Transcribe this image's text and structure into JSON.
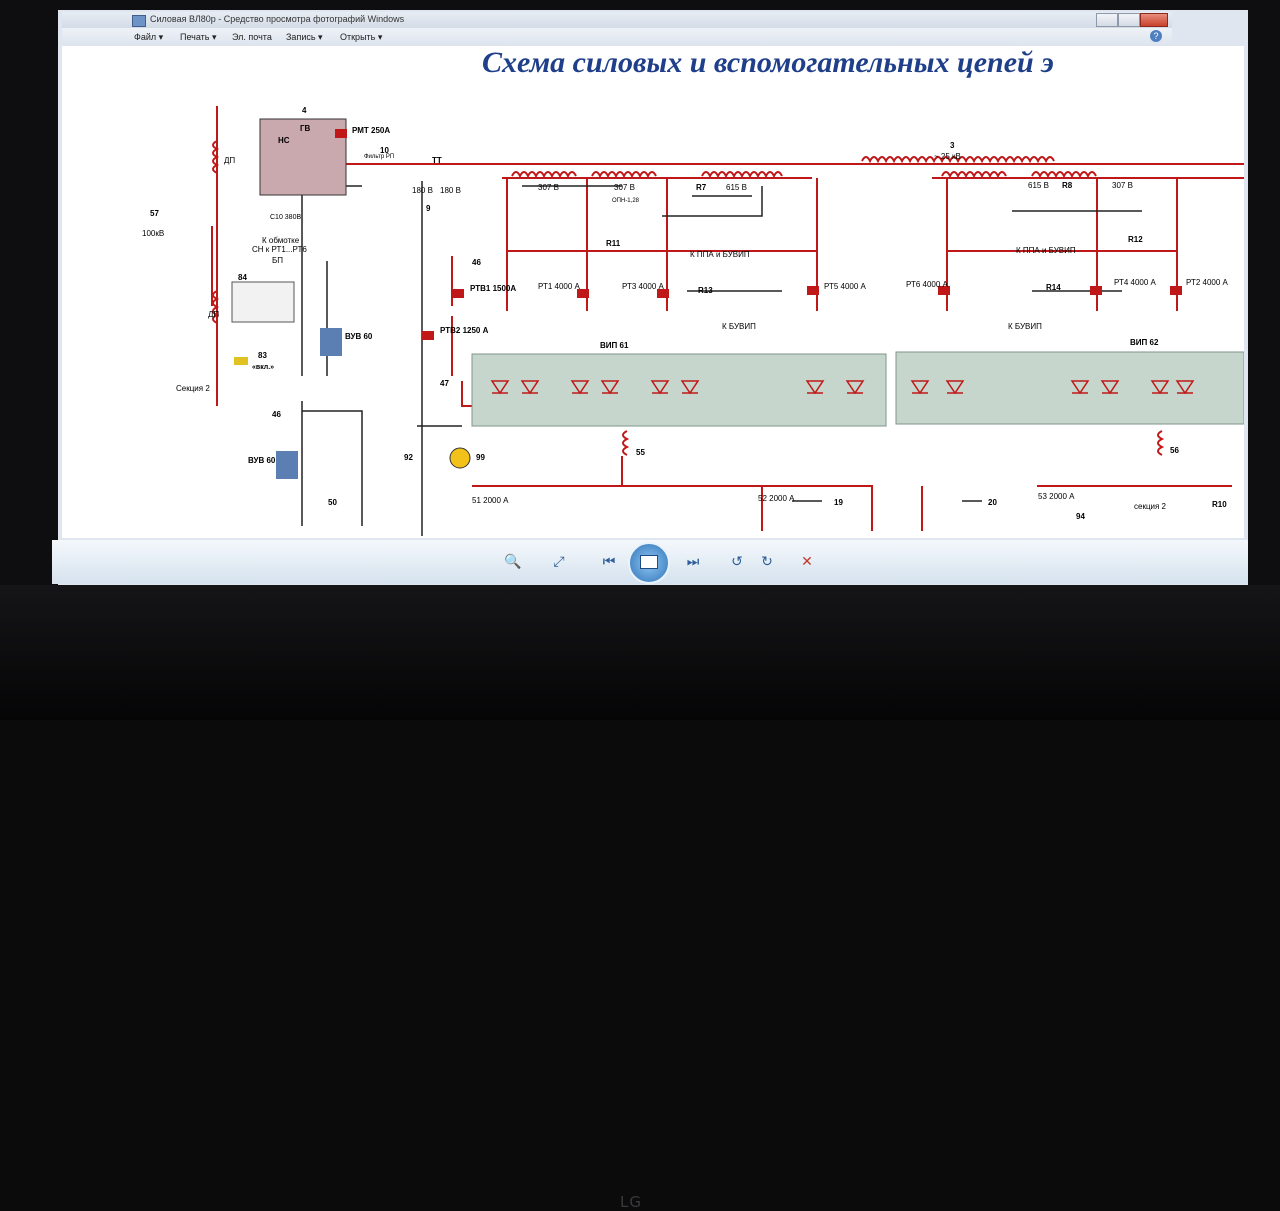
{
  "window": {
    "title": "Силовая ВЛ80р - Средство просмотра фотографий Windows"
  },
  "menu": {
    "items": [
      "Файл ▾",
      "Печать ▾",
      "Эл. почта",
      "Запись ▾",
      "Открыть ▾"
    ],
    "help": "?"
  },
  "document": {
    "title": "Схема силовых и вспомогательных цепей э",
    "labels": {
      "gv": "ГВ",
      "rmt": "РМТ 250А",
      "ns": "НС",
      "tt": "ТТ",
      "filter": "Фильтр РП",
      "v25": "~ 25 кВ",
      "dp": "ДП",
      "section2": "Секция 2",
      "section2b": "секция 2",
      "kv100": "100кВ",
      "bp": "БП",
      "obmotke": "К обмотке",
      "sn": "СН к РТ1...РТ6",
      "c10": "С10 380В",
      "vkl": "«вкл.»",
      "vuv60a": "ВУВ 60",
      "vuv60b": "ВУВ 60",
      "rtv1": "РТВ1 1500А",
      "rtv2": "РТВ2 1250 А",
      "v307a": "307 В",
      "v307b": "307 В",
      "v615a": "615 В",
      "v615b": "615 В",
      "v307c": "307 В",
      "v180a": "180 В",
      "v180b": "180 В",
      "opn": "ОПН-1,28",
      "kppa": "К ППА и БУВИП",
      "kppa2": "К ППА и БУВИП",
      "kbuvip": "К БУВИП",
      "kbuvip2": "К БУВИП",
      "vip61": "ВИП 61",
      "vip62": "ВИП 62",
      "pt1": "РТ1 4000 А",
      "pt3": "РТ3 4000 А",
      "pt5": "РТ5 4000 А",
      "pt6": "РТ6 4000 А",
      "pt4": "РТ4 4000 А",
      "pt2": "РТ2 4000 А",
      "r7": "R7",
      "r8": "R8",
      "r11": "R11",
      "r12": "R12",
      "r13": "R13",
      "r14": "R14",
      "r10": "R10",
      "n51": "51 2000 А",
      "n52": "52 2000 А",
      "n53": "53 2000 А",
      "n92": "92",
      "n99": "99",
      "n55": "55",
      "n56": "56",
      "n19": "19",
      "n20": "20",
      "n94": "94",
      "n57": "57",
      "n84": "84",
      "n83": "83",
      "n46a": "46",
      "n46b": "46",
      "n47": "47",
      "n50": "50",
      "n9": "9",
      "n10": "10",
      "n3": "3",
      "n4": "4"
    }
  },
  "toolbar": {
    "zoom": "🔍",
    "fit": "⤢",
    "prev": "⏮",
    "next": "⏭",
    "rotate_left": "↺",
    "rotate_right": "↻",
    "delete": "✕"
  },
  "monitor": {
    "brand": "LG"
  }
}
